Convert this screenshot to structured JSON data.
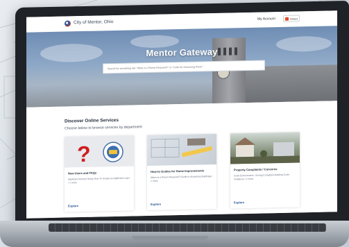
{
  "colors": {
    "header_bg": "#ffffff",
    "hero_overlay": "#6f8db4",
    "link": "#1e4e8c",
    "laptop_frame": "#1f2226"
  },
  "header": {
    "site_name": "City of Mentor, Ohio",
    "my_account": "My Account",
    "language": "Select"
  },
  "hero": {
    "title": "Mentor Gateway",
    "search_placeholder": "Search for something like \"What is a Permit Required?\" or \"Code for Swimming Pools\""
  },
  "services": {
    "heading": "Discover Online Services",
    "subheading": "Choose below to browse services by department",
    "cards": [
      {
        "title": "New Users and FAQs",
        "description": "Applicant Account Setup   How To Create an Applicant Login  •  1 more",
        "link": "Explore",
        "image_icon": "question-mark-icon"
      },
      {
        "title": "How-to Guides for Home Improvements",
        "description": "When is a Permit Required?   Guide to Accessory Buildings  •  1 more",
        "link": "Explore",
        "image_icon": "blueprint-icon"
      },
      {
        "title": "Property Complaints / Concerns",
        "description": "Code Enforcement / Zoning Complaint   Building Code Violations  •  1 more",
        "link": "Explore",
        "image_icon": "house-icon"
      }
    ]
  }
}
